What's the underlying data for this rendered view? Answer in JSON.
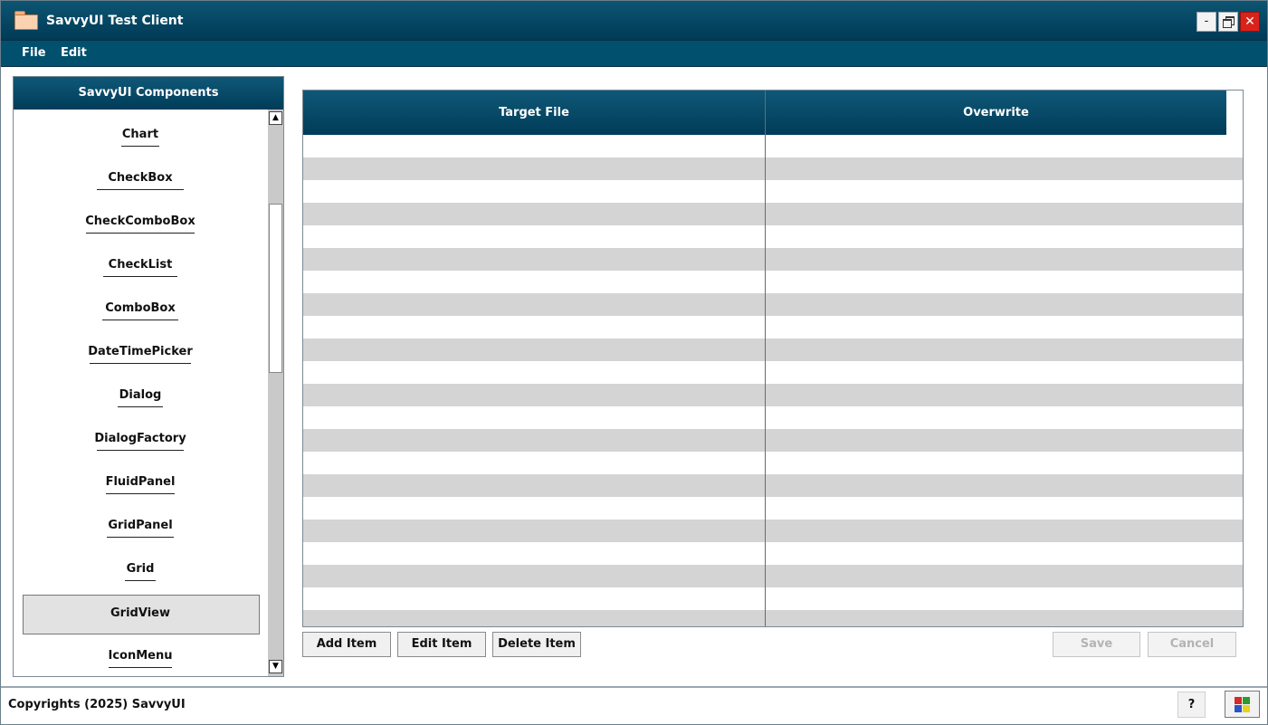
{
  "window": {
    "title": "SavvyUI Test Client",
    "minimize_label": "-",
    "close_label": "✕"
  },
  "menu": {
    "items": [
      {
        "label": "File"
      },
      {
        "label": "Edit"
      }
    ]
  },
  "components_panel": {
    "title": "SavvyUI Components",
    "items": [
      {
        "label": "Chart"
      },
      {
        "label": "CheckBox"
      },
      {
        "label": "CheckComboBox"
      },
      {
        "label": "CheckList"
      },
      {
        "label": "ComboBox"
      },
      {
        "label": "DateTimePicker"
      },
      {
        "label": "Dialog"
      },
      {
        "label": "DialogFactory"
      },
      {
        "label": "FluidPanel"
      },
      {
        "label": "GridPanel"
      },
      {
        "label": "Grid"
      },
      {
        "label": "GridView"
      },
      {
        "label": "IconMenu"
      }
    ],
    "selected": "GridView",
    "scroll_up": "▲",
    "scroll_down": "▼"
  },
  "grid": {
    "columns": [
      {
        "label": "Target File"
      },
      {
        "label": "Overwrite"
      }
    ],
    "row_count": 22,
    "stripe_color": "#d4d4d4"
  },
  "actions": {
    "add": "Add Item",
    "edit": "Edit Item",
    "delete": "Delete Item",
    "save": "Save",
    "cancel": "Cancel"
  },
  "status_bar": {
    "copyright": "Copyrights (2025) SavvyUI",
    "help": "?",
    "apps_colors": [
      "#d42a2a",
      "#2c9b2c",
      "#2a55c8",
      "#e8d21f"
    ]
  },
  "theme": {
    "primary": "#00506e",
    "header_top": "#0f5878",
    "header_bottom": "#003c58"
  }
}
